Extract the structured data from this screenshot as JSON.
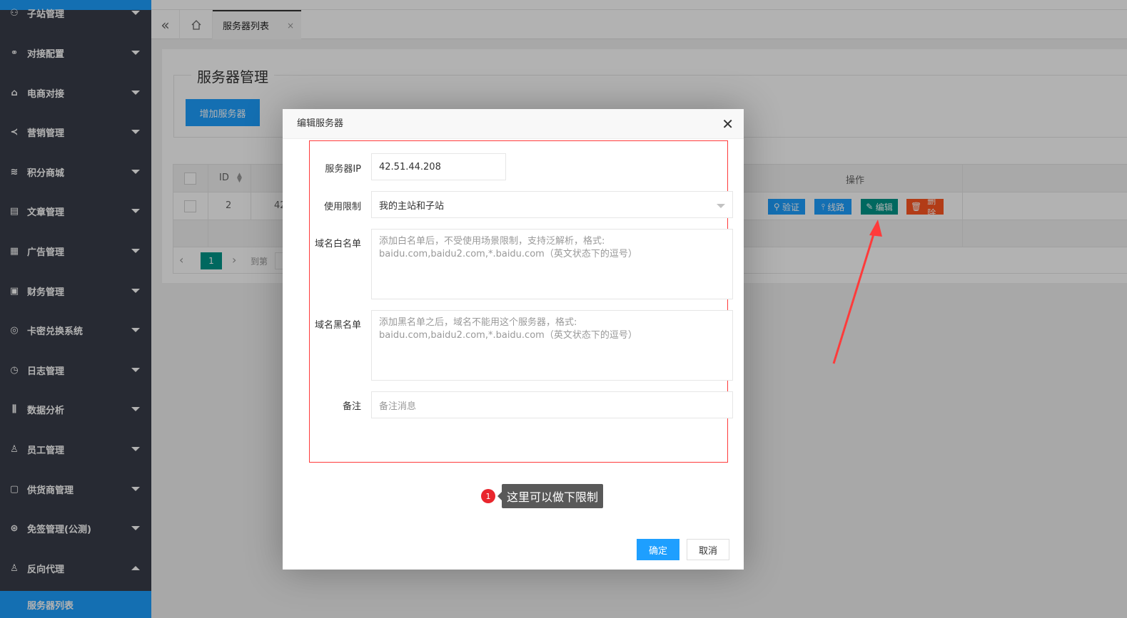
{
  "sidebar": {
    "items": [
      {
        "label": "子站管理",
        "icon": "sitemap-icon"
      },
      {
        "label": "对接配置",
        "icon": "link-icon"
      },
      {
        "label": "电商对接",
        "icon": "shop-icon"
      },
      {
        "label": "营销管理",
        "icon": "share-icon"
      },
      {
        "label": "积分商城",
        "icon": "database-icon"
      },
      {
        "label": "文章管理",
        "icon": "doc-icon"
      },
      {
        "label": "广告管理",
        "icon": "ad-icon"
      },
      {
        "label": "财务管理",
        "icon": "finance-icon"
      },
      {
        "label": "卡密兑换系统",
        "icon": "card-icon"
      },
      {
        "label": "日志管理",
        "icon": "clock-icon"
      },
      {
        "label": "数据分析",
        "icon": "chart-icon"
      },
      {
        "label": "员工管理",
        "icon": "user-icon"
      },
      {
        "label": "供货商管理",
        "icon": "supplier-icon"
      },
      {
        "label": "免签管理(公测)",
        "icon": "sign-icon"
      },
      {
        "label": "反向代理",
        "icon": "proxy-icon"
      }
    ],
    "active_sub": "服务器列表"
  },
  "tabs": {
    "active_label": "服务器列表",
    "close_glyph": "×"
  },
  "page": {
    "legend": "服务器管理",
    "add_button": "增加服务器"
  },
  "table": {
    "header_id": "ID",
    "header_op": "操作",
    "rows": [
      {
        "id": "2",
        "ip": "42"
      }
    ],
    "ops": {
      "verify": "验证",
      "route": "线路",
      "edit": "编辑",
      "delete": "删除"
    },
    "pager": {
      "current": "1",
      "goto_label": "到第"
    }
  },
  "dialog": {
    "title": "编辑服务器",
    "fields": {
      "ip_label": "服务器IP",
      "ip_value": "42.51.44.208",
      "limit_label": "使用限制",
      "limit_value": "我的主站和子站",
      "whitelist_label": "域名白名单",
      "whitelist_placeholder": "添加白名单后，不受使用场景限制，支持泛解析，格式: baidu.com,baidu2.com,*.baidu.com（英文状态下的逗号）",
      "blacklist_label": "域名黑名单",
      "blacklist_placeholder": "添加黑名单之后，域名不能用这个服务器，格式: baidu.com,baidu2.com,*.baidu.com（英文状态下的逗号）",
      "remark_label": "备注",
      "remark_placeholder": "备注消息"
    },
    "tip_number": "1",
    "tip_text": "这里可以做下限制",
    "ok": "确定",
    "cancel": "取消"
  },
  "colors": {
    "sidebar_bg": "#393d49",
    "accent": "#1e9fff",
    "teal": "#009688",
    "danger": "#ff5722",
    "annotation_red": "#ff3b3b"
  }
}
